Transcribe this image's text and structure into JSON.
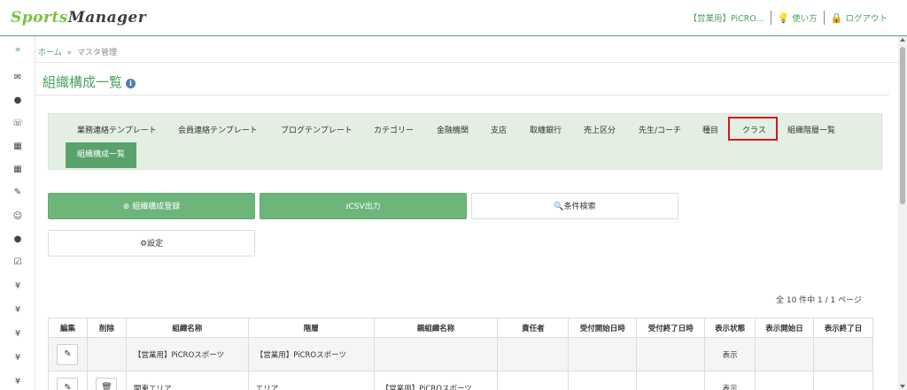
{
  "header": {
    "logo_green": "Sports",
    "logo_dark": "Manager",
    "account": "【営業用】PiCRO...",
    "help": "使い方",
    "logout": "ログアウト"
  },
  "sidebar": {
    "toggle": "»",
    "yen_symbol": "¥"
  },
  "breadcrumb": {
    "home": "ホーム",
    "separator": "»",
    "current": "マスタ管理"
  },
  "page": {
    "title": "組織構成一覧",
    "info": "i"
  },
  "tabs": [
    {
      "label": "業務連絡テンプレート"
    },
    {
      "label": "会員連絡テンプレート"
    },
    {
      "label": "ブログテンプレート"
    },
    {
      "label": "カテゴリー"
    },
    {
      "label": "金融機関"
    },
    {
      "label": "支店"
    },
    {
      "label": "取纏銀行"
    },
    {
      "label": "売上区分"
    },
    {
      "label": "先生/コーチ"
    },
    {
      "label": "種目"
    },
    {
      "label": "クラス"
    },
    {
      "label": "組織階層一覧"
    }
  ],
  "active_tab": "組織構成一覧",
  "actions": {
    "register": "組織構成登録",
    "csv": "CSV出力",
    "search": "条件検索",
    "settings": "設定"
  },
  "pagination": {
    "info": "全 10 件中 1 / 1 ページ"
  },
  "table": {
    "headers": [
      "編集",
      "削除",
      "組織名称",
      "階層",
      "親組織名称",
      "責任者",
      "受付開始日時",
      "受付終了日時",
      "表示状態",
      "表示開始日",
      "表示終了日"
    ],
    "rows": [
      {
        "name": "【営業用】PiCROスポーツ",
        "level": "【営業用】PiCROスポーツ",
        "parent": "",
        "manager": "",
        "start": "",
        "end": "",
        "status": "表示",
        "disp_start": "",
        "disp_end": ""
      },
      {
        "name": "関東エリア",
        "level": "エリア",
        "parent": "【営業用】PiCROスポーツ",
        "manager": "",
        "start": "",
        "end": "",
        "status": "表示",
        "disp_start": "",
        "disp_end": ""
      }
    ]
  },
  "colors": {
    "accent": "#4aa060",
    "button_green": "#6db57b",
    "tab_bg": "#e3efe3",
    "highlight": "#e0101a"
  }
}
